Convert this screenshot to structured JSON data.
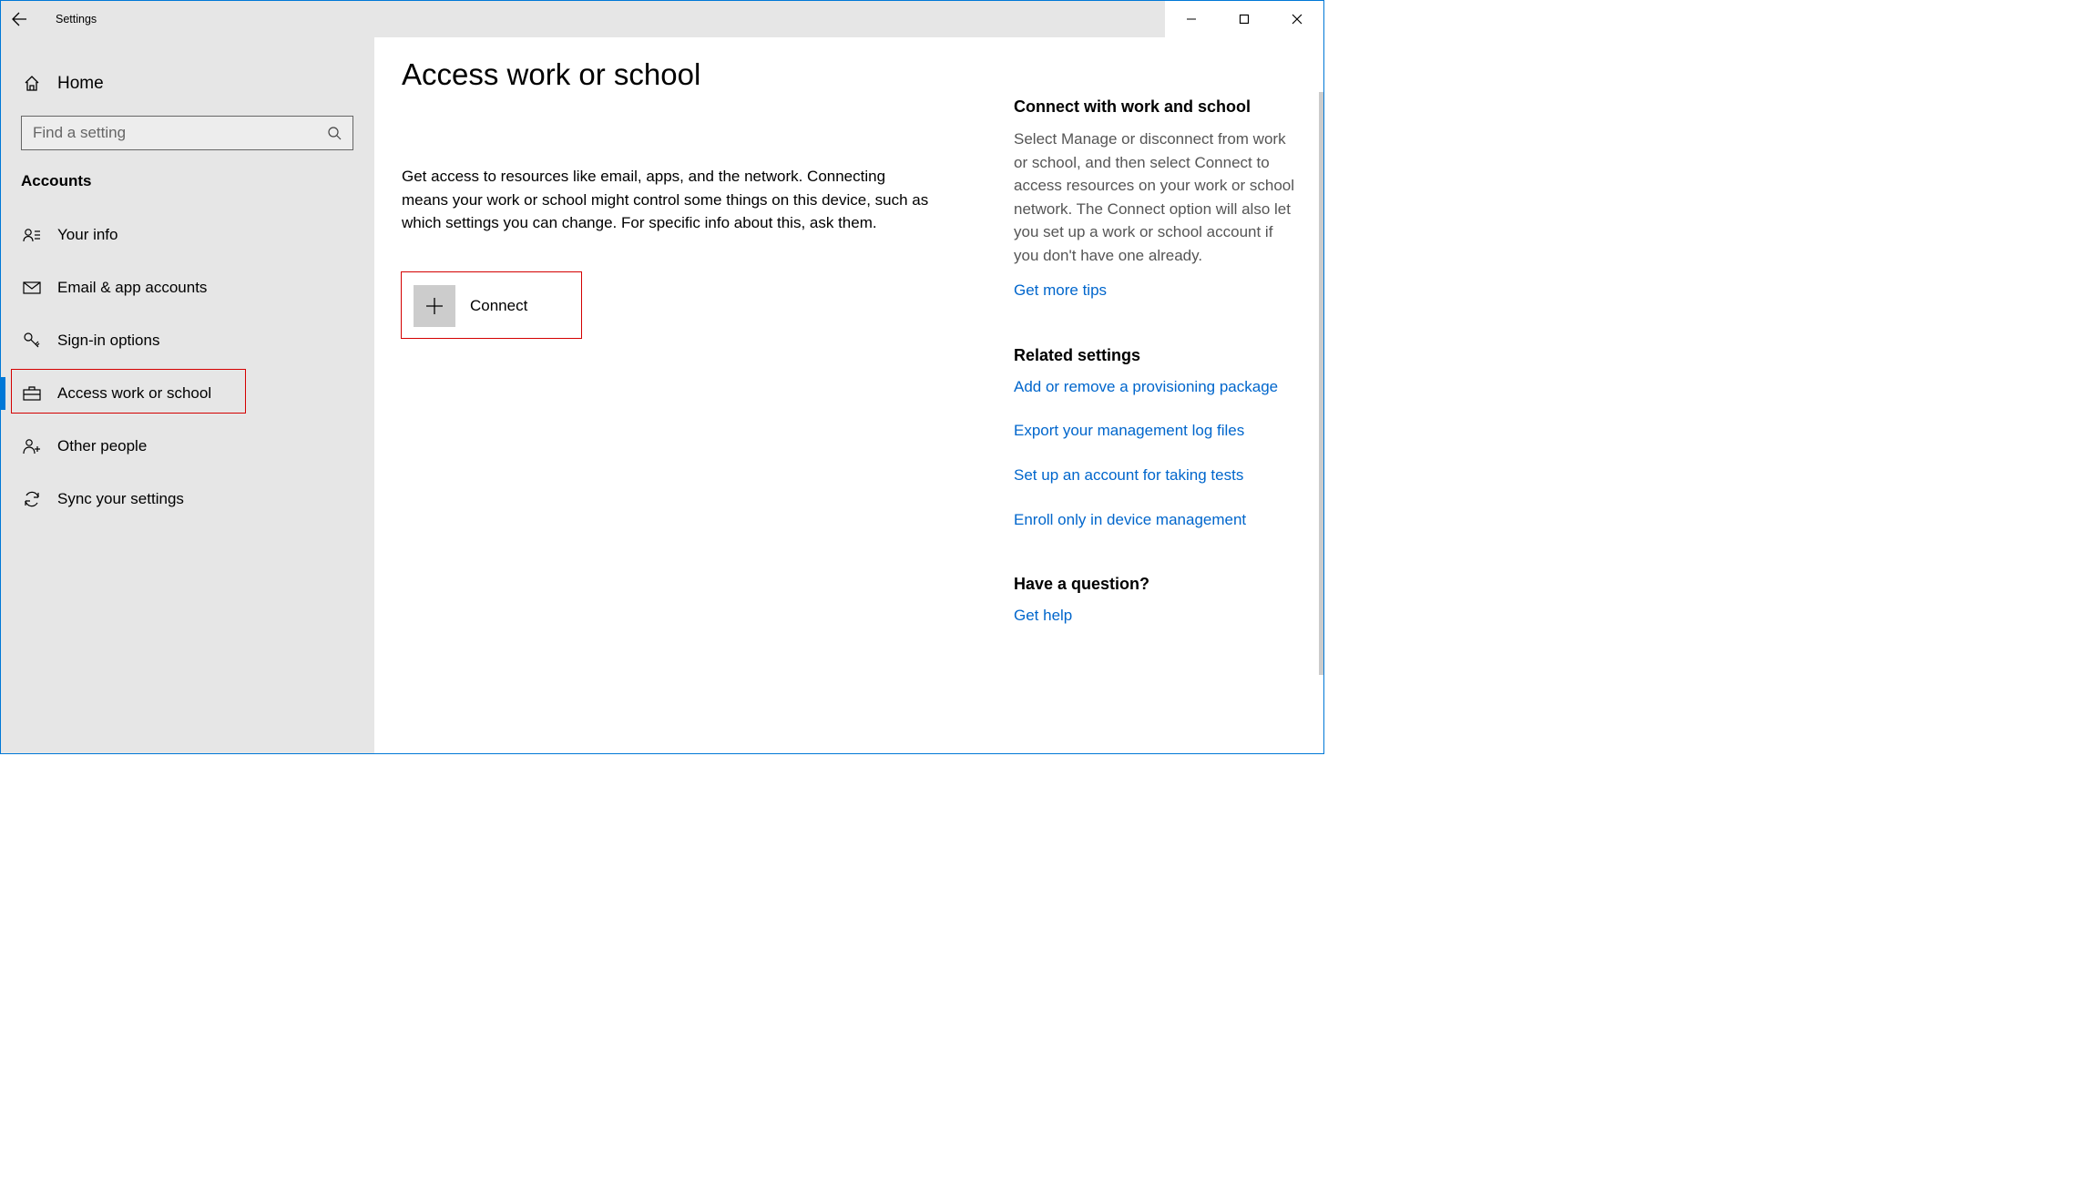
{
  "window": {
    "title": "Settings"
  },
  "sidebar": {
    "home_label": "Home",
    "search_placeholder": "Find a setting",
    "section": "Accounts",
    "items": [
      {
        "label": "Your info"
      },
      {
        "label": "Email & app accounts"
      },
      {
        "label": "Sign-in options"
      },
      {
        "label": "Access work or school"
      },
      {
        "label": "Other people"
      },
      {
        "label": "Sync your settings"
      }
    ]
  },
  "page": {
    "title": "Access work or school",
    "description": "Get access to resources like email, apps, and the network. Connecting means your work or school might control some things on this device, such as which settings you can change. For specific info about this, ask them.",
    "connect_label": "Connect"
  },
  "side": {
    "connect_heading": "Connect with work and school",
    "connect_text": "Select Manage or disconnect from work or school, and then select Connect to access resources on your work or school network. The Connect option will also let you set up a work or school account if you don't have one already.",
    "tips_link": "Get more tips",
    "related_heading": "Related settings",
    "related_links": [
      "Add or remove a provisioning package",
      "Export your management log files",
      "Set up an account for taking tests",
      "Enroll only in device management"
    ],
    "question_heading": "Have a question?",
    "help_link": "Get help"
  }
}
